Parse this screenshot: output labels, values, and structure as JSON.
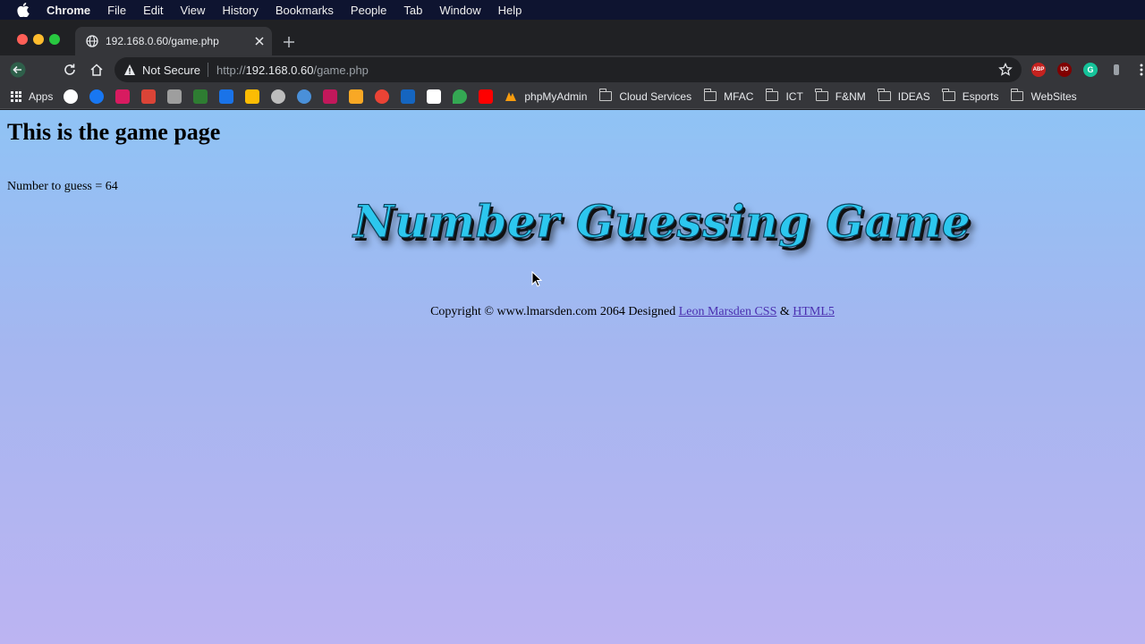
{
  "menubar": {
    "app_name": "Chrome",
    "items": [
      "File",
      "Edit",
      "View",
      "History",
      "Bookmarks",
      "People",
      "Tab",
      "Window",
      "Help"
    ]
  },
  "tab": {
    "title": "192.168.0.60/game.php",
    "icon": "globe-icon"
  },
  "omnibox": {
    "security_label": "Not Secure",
    "url_scheme": "http://",
    "url_host": "192.168.0.60",
    "url_path": "/game.php"
  },
  "bookmarks": {
    "apps_label": "Apps",
    "favicon_colors": [
      "#4285f4",
      "#1877f2",
      "#d81b60",
      "#db4437",
      "#9e9e9e",
      "#2e7d32",
      "#1a73e8",
      "#fbbc04",
      "#bdbdbd",
      "#4a90d9",
      "#c2185b",
      "#f9a825",
      "#ea4335",
      "#1565c0",
      "#fbbc04",
      "#34a853",
      "#ff0000"
    ],
    "links": [
      {
        "label": "phpMyAdmin",
        "icon": "phpmyadmin-icon"
      },
      {
        "label": "Cloud Services",
        "icon": "folder-icon"
      },
      {
        "label": "MFAC",
        "icon": "folder-icon"
      },
      {
        "label": "ICT",
        "icon": "folder-icon"
      },
      {
        "label": "F&NM",
        "icon": "folder-icon"
      },
      {
        "label": "IDEAS",
        "icon": "folder-icon"
      },
      {
        "label": "Esports",
        "icon": "folder-icon"
      },
      {
        "label": "WebSites",
        "icon": "folder-icon"
      }
    ]
  },
  "extensions": {
    "abp": "ABP",
    "ublock": "UO",
    "grammarly": "G"
  },
  "page": {
    "heading": "This is the game page",
    "guess_line": "Number to guess = 64",
    "game_title": "Number Guessing Game",
    "footer_text": "Copyright © www.lmarsden.com 2064 Designed",
    "footer_link1": "Leon Marsden CSS",
    "footer_amp": "&",
    "footer_link2": "HTML5"
  },
  "colors": {
    "title_fill": "#2cc7ee",
    "bg_top": "#8fc3f5",
    "bg_bottom": "#bcb4f2",
    "link": "#4a2fb0"
  }
}
